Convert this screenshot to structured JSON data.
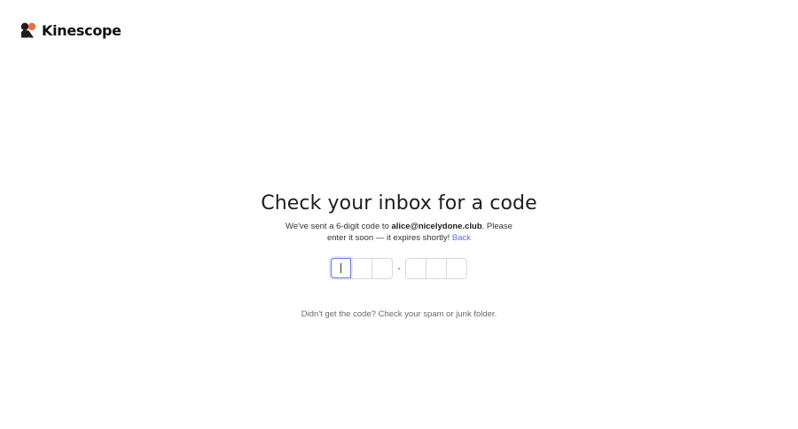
{
  "header": {
    "brand_name": "Kinescope",
    "logo_icon": "kinescope-logo-icon",
    "logo_colors": [
      "#f26a3d",
      "#1d1d1f"
    ]
  },
  "main": {
    "title": "Check your inbox for a code",
    "message_prefix": "We've sent a 6-digit code to ",
    "email": "alice@nicelydone.club",
    "message_suffix": ". Please enter it soon — it expires shortly!",
    "back_link": "Back",
    "code_inputs": {
      "first_group": [
        "",
        "",
        ""
      ],
      "separator": "-",
      "second_group": [
        "",
        "",
        ""
      ],
      "active_index": 0
    },
    "hint": "Didn't get the code? Check your spam or junk folder."
  },
  "colors": {
    "accent": "#5b6cf0",
    "focus_border": "#6b79f2",
    "input_border": "#d6d9de"
  }
}
